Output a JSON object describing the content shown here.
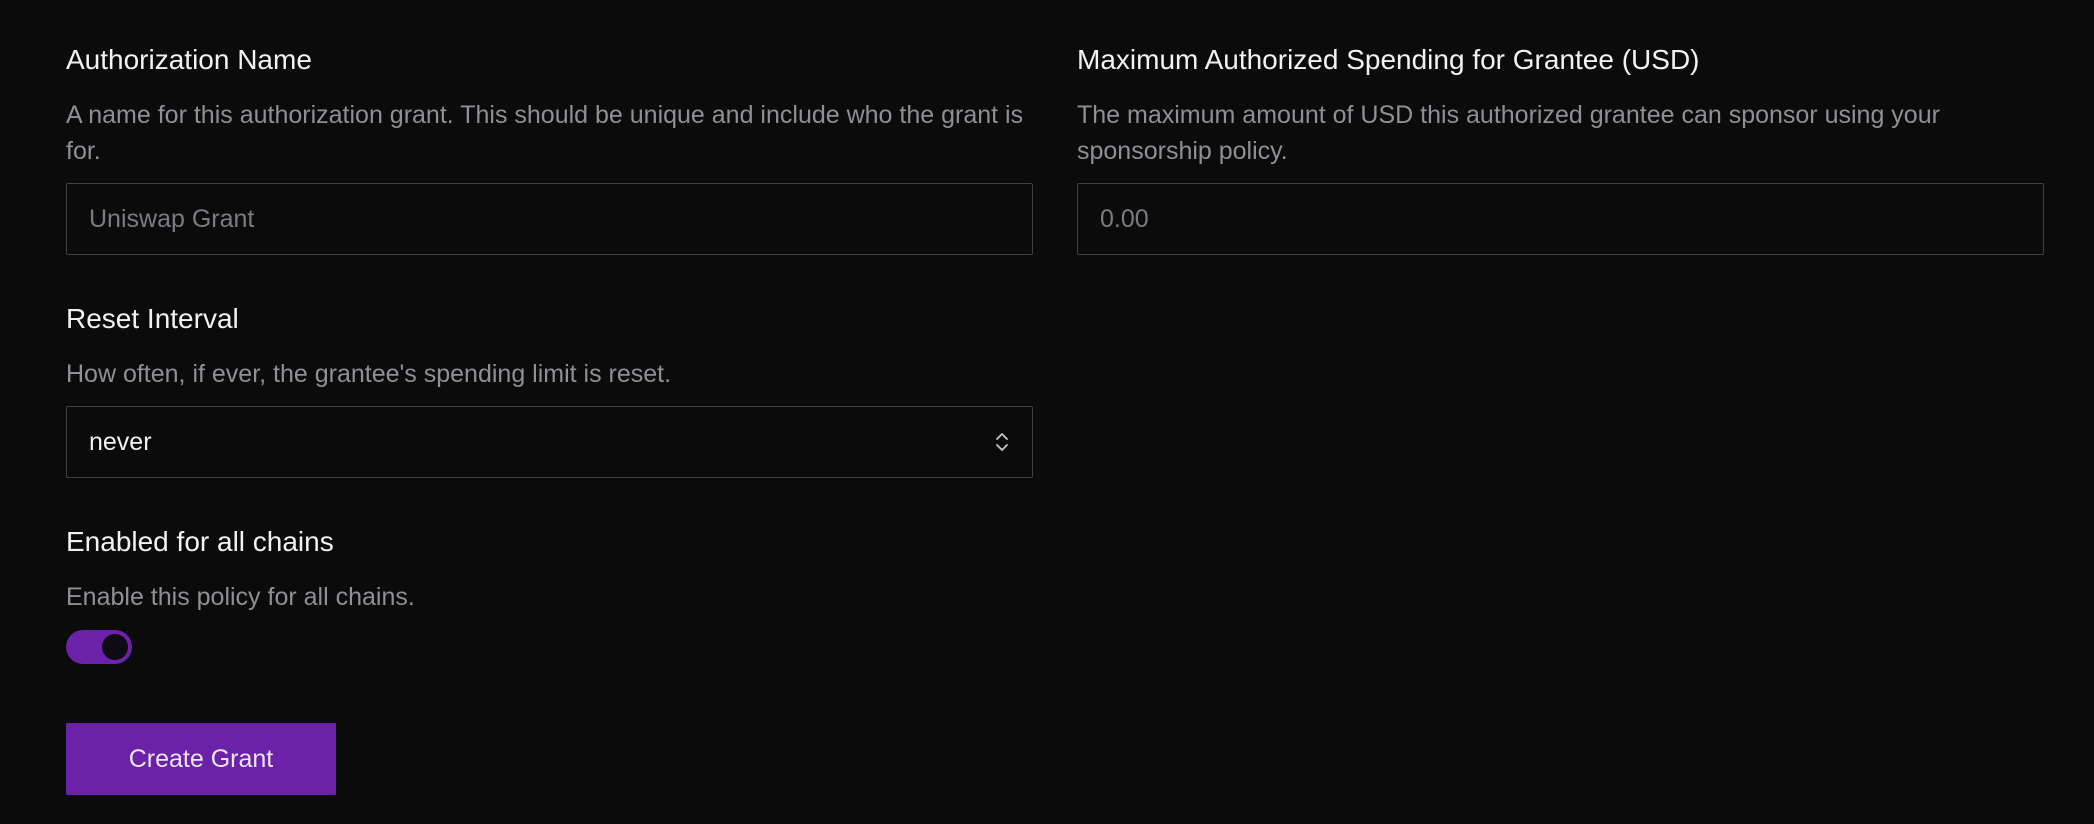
{
  "form": {
    "authorization_name": {
      "label": "Authorization Name",
      "description": "A name for this authorization grant. This should be unique and include who the grant is for.",
      "placeholder": "Uniswap Grant",
      "value": ""
    },
    "max_spending": {
      "label": "Maximum Authorized Spending for Grantee (USD)",
      "description": "The maximum amount of USD this authorized grantee can sponsor using your sponsorship policy.",
      "placeholder": "0.00",
      "value": ""
    },
    "reset_interval": {
      "label": "Reset Interval",
      "description": "How often, if ever, the grantee's spending limit is reset.",
      "selected": "never"
    },
    "all_chains": {
      "label": "Enabled for all chains",
      "description": "Enable this policy for all chains.",
      "enabled": true
    },
    "submit_label": "Create Grant"
  },
  "colors": {
    "background": "#0b0b0c",
    "accent": "#6b21a8",
    "text_primary": "#f2f2f4",
    "text_muted": "#8f8f95",
    "border": "#3e3e43"
  }
}
